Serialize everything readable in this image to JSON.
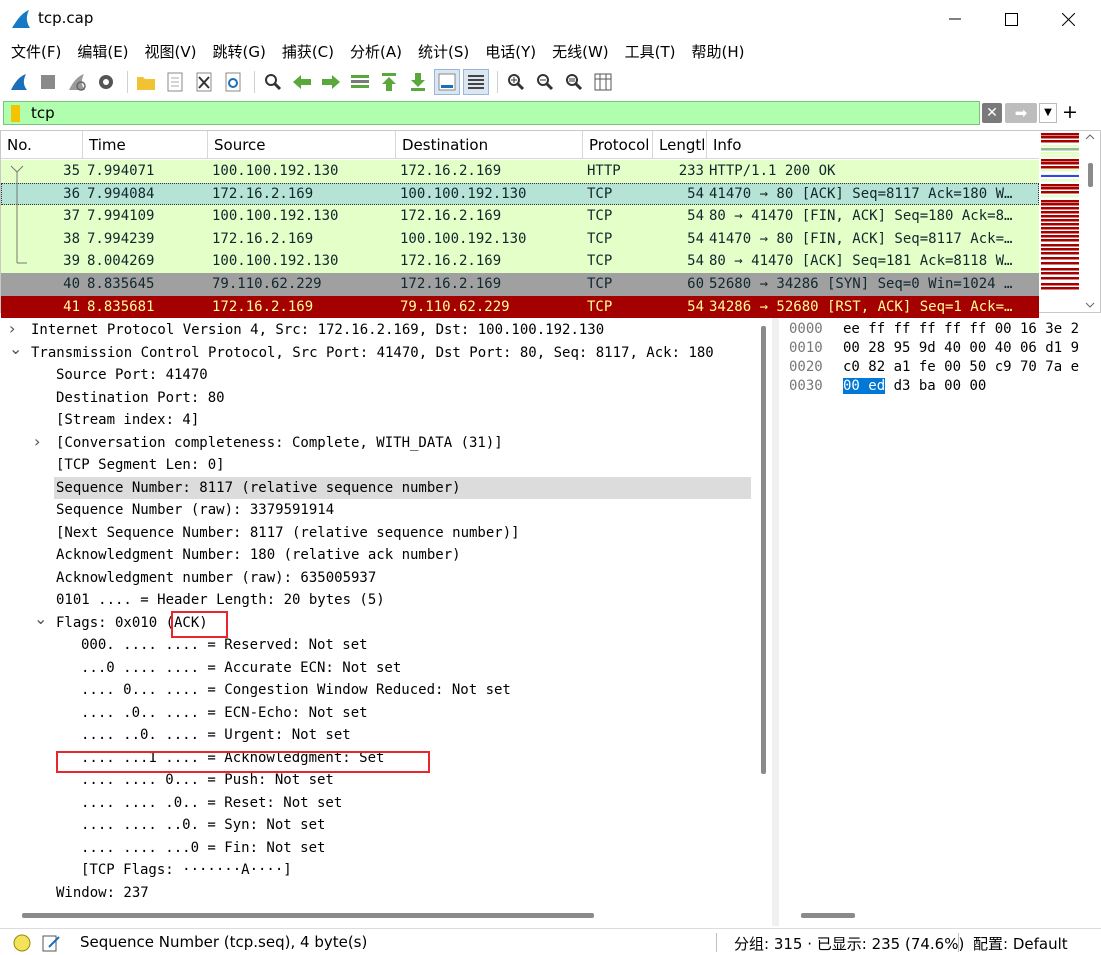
{
  "window": {
    "title": "tcp.cap"
  },
  "menu": [
    "文件(F)",
    "编辑(E)",
    "视图(V)",
    "跳转(G)",
    "捕获(C)",
    "分析(A)",
    "统计(S)",
    "电话(Y)",
    "无线(W)",
    "工具(T)",
    "帮助(H)"
  ],
  "filter": {
    "value": "tcp"
  },
  "packet_list": {
    "columns": [
      "No.",
      "Time",
      "Source",
      "Destination",
      "Protocol",
      "Lengtl",
      "Info"
    ],
    "rows": [
      {
        "no": "35",
        "time": "7.994071",
        "src": "100.100.192.130",
        "dst": "172.16.2.169",
        "proto": "HTTP",
        "len": "233",
        "info": "HTTP/1.1 200 OK",
        "bg": "#e4ffc7",
        "fg": "#12272e"
      },
      {
        "no": "36",
        "time": "7.994084",
        "src": "172.16.2.169",
        "dst": "100.100.192.130",
        "proto": "TCP",
        "len": "54",
        "info": "41470 → 80 [ACK] Seq=8117 Ack=180 W…",
        "bg": "#b5e3d5",
        "fg": "#12272e",
        "selected": true
      },
      {
        "no": "37",
        "time": "7.994109",
        "src": "100.100.192.130",
        "dst": "172.16.2.169",
        "proto": "TCP",
        "len": "54",
        "info": "80 → 41470 [FIN, ACK] Seq=180 Ack=8…",
        "bg": "#e4ffc7",
        "fg": "#12272e"
      },
      {
        "no": "38",
        "time": "7.994239",
        "src": "172.16.2.169",
        "dst": "100.100.192.130",
        "proto": "TCP",
        "len": "54",
        "info": "41470 → 80 [FIN, ACK] Seq=8117 Ack=…",
        "bg": "#e4ffc7",
        "fg": "#12272e"
      },
      {
        "no": "39",
        "time": "8.004269",
        "src": "100.100.192.130",
        "dst": "172.16.2.169",
        "proto": "TCP",
        "len": "54",
        "info": "80 → 41470 [ACK] Seq=181 Ack=8118 W…",
        "bg": "#e4ffc7",
        "fg": "#12272e"
      },
      {
        "no": "40",
        "time": "8.835645",
        "src": "79.110.62.229",
        "dst": "172.16.2.169",
        "proto": "TCP",
        "len": "60",
        "info": "52680 → 34286 [SYN] Seq=0 Win=1024 …",
        "bg": "#a0a0a0",
        "fg": "#12272e"
      },
      {
        "no": "41",
        "time": "8.835681",
        "src": "172.16.2.169",
        "dst": "79.110.62.229",
        "proto": "TCP",
        "len": "54",
        "info": "34286 → 52680 [RST, ACK] Seq=1 Ack=…",
        "bg": "#a40000",
        "fg": "#fffc9c"
      }
    ]
  },
  "details": [
    {
      "text": "Internet Protocol Version 4, Src: 172.16.2.169, Dst: 100.100.192.130",
      "indent": 0,
      "arrow": "collapsed"
    },
    {
      "text": "Transmission Control Protocol, Src Port: 41470, Dst Port: 80, Seq: 8117, Ack: 180",
      "indent": 0,
      "arrow": "expanded"
    },
    {
      "text": "Source Port: 41470",
      "indent": 1
    },
    {
      "text": "Destination Port: 80",
      "indent": 1
    },
    {
      "text": "[Stream index: 4]",
      "indent": 1
    },
    {
      "text": "[Conversation completeness: Complete, WITH_DATA (31)]",
      "indent": 1,
      "arrow": "collapsed"
    },
    {
      "text": "[TCP Segment Len: 0]",
      "indent": 1
    },
    {
      "text": "Sequence Number: 8117    (relative sequence number)",
      "indent": 1,
      "selected": true
    },
    {
      "text": "Sequence Number (raw): 3379591914",
      "indent": 1
    },
    {
      "text": "[Next Sequence Number: 8117    (relative sequence number)]",
      "indent": 1
    },
    {
      "text": "Acknowledgment Number: 180    (relative ack number)",
      "indent": 1
    },
    {
      "text": "Acknowledgment number (raw): 635005937",
      "indent": 1
    },
    {
      "text": "0101 .... = Header Length: 20 bytes (5)",
      "indent": 1
    },
    {
      "text": "Flags: 0x010 (ACK)",
      "indent": 1,
      "arrow": "expanded"
    },
    {
      "text": "000. .... .... = Reserved: Not set",
      "indent": 2
    },
    {
      "text": "...0 .... .... = Accurate ECN: Not set",
      "indent": 2
    },
    {
      "text": ".... 0... .... = Congestion Window Reduced: Not set",
      "indent": 2
    },
    {
      "text": ".... .0.. .... = ECN-Echo: Not set",
      "indent": 2
    },
    {
      "text": ".... ..0. .... = Urgent: Not set",
      "indent": 2
    },
    {
      "text": ".... ...1 .... = Acknowledgment: Set",
      "indent": 2
    },
    {
      "text": ".... .... 0... = Push: Not set",
      "indent": 2
    },
    {
      "text": ".... .... .0.. = Reset: Not set",
      "indent": 2
    },
    {
      "text": ".... .... ..0. = Syn: Not set",
      "indent": 2
    },
    {
      "text": ".... .... ...0 = Fin: Not set",
      "indent": 2
    },
    {
      "text": "[TCP Flags: ·······A····]",
      "indent": 2
    },
    {
      "text": "Window: 237",
      "indent": 1
    }
  ],
  "hex": [
    {
      "offset": "0000",
      "bytes": "ee ff ff ff ff ff 00 16  3e 2"
    },
    {
      "offset": "0010",
      "bytes": "00 28 95 9d 40 00 40 06  d1 9"
    },
    {
      "offset": "0020",
      "bytes": "c0 82 a1 fe 00 50 c9 70  7a e"
    },
    {
      "offset": "0030",
      "bytes": "00 ed",
      "rest": " d3 ba 00 00"
    }
  ],
  "status": {
    "field": "Sequence Number (tcp.seq), 4 byte(s)",
    "packets": "分组: 315 · 已显示: 235 (74.6%)",
    "profile": "配置: Default"
  },
  "colors": {
    "accent": "#0078d7",
    "highlight_box": "#e8262b",
    "filter_bg": "#afffaf"
  }
}
